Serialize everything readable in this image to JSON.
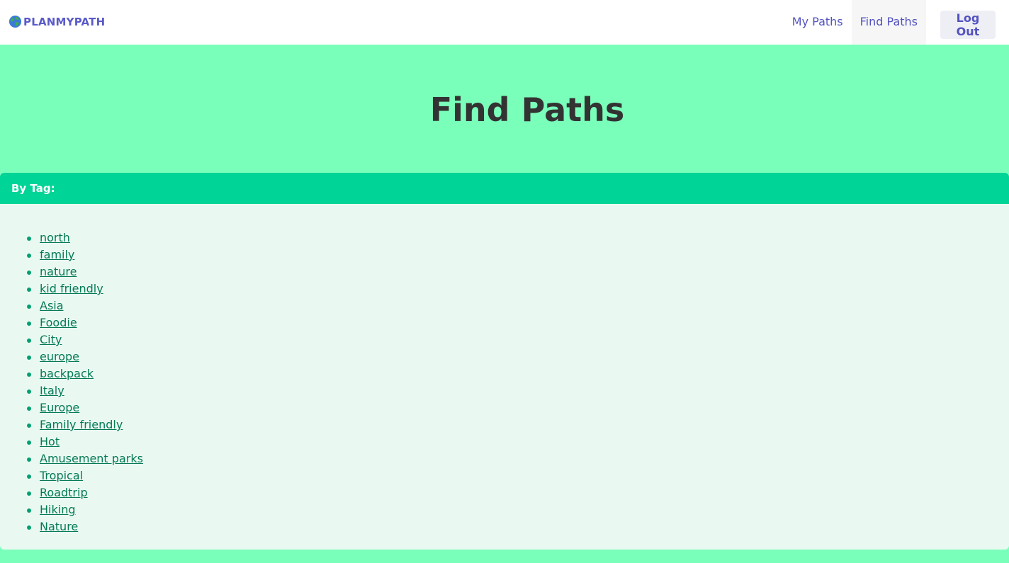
{
  "brand": {
    "name": "PLANMYPATH",
    "icon": "globe-icon"
  },
  "nav": {
    "my_paths": "My Paths",
    "find_paths": "Find Paths",
    "logout": "Log Out"
  },
  "hero": {
    "title": "Find Paths"
  },
  "tags": {
    "header": "By Tag:",
    "items": [
      "north",
      "family",
      "nature",
      "kid friendly",
      "Asia",
      "Foodie",
      "City",
      "europe",
      "backpack",
      "Italy",
      "Europe",
      "Family friendly",
      "Hot",
      "Amusement parks",
      "Tropical",
      "Roadtrip",
      "Hiking",
      "Nature"
    ]
  },
  "colors": {
    "page_bg": "#7affba",
    "header_bar": "#00d496",
    "card_bg": "#e9f9f2",
    "link": "#057a55",
    "nav_text": "#5252c0",
    "title_text": "#333333"
  }
}
